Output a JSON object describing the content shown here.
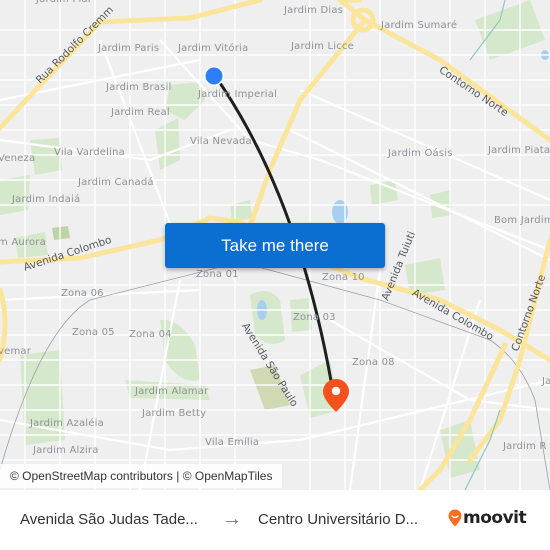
{
  "map": {
    "neighborhood_labels": [
      {
        "id": "jardim-piar",
        "text": "Jardim Piar"
      },
      {
        "id": "jardim-dias",
        "text": "Jardim Dias"
      },
      {
        "id": "jardim-sumare",
        "text": "Jardim Sumaré"
      },
      {
        "id": "jardim-paris",
        "text": "Jardim Paris"
      },
      {
        "id": "jardim-vitoria",
        "text": "Jardim Vitória"
      },
      {
        "id": "jardim-licce",
        "text": "Jardim Licce"
      },
      {
        "id": "jardim-brasil",
        "text": "Jardim Brasil"
      },
      {
        "id": "jardim-imperial",
        "text": "Jardim Imperial"
      },
      {
        "id": "jardim-real",
        "text": "Jardim Real"
      },
      {
        "id": "vila-nevada",
        "text": "Vila Nevada"
      },
      {
        "id": "veneza",
        "text": "Veneza"
      },
      {
        "id": "vila-vardelina",
        "text": "Vila Vardelina"
      },
      {
        "id": "jardim-oasis",
        "text": "Jardim Oásis"
      },
      {
        "id": "jardim-piata",
        "text": "Jardim Piata"
      },
      {
        "id": "jardim-canada",
        "text": "Jardim Canadá"
      },
      {
        "id": "jardim-indaia",
        "text": "Jardim Indaiá"
      },
      {
        "id": "bom-jardim",
        "text": "Bom Jardim"
      },
      {
        "id": "jardim-aurora",
        "text": "m Aurora"
      },
      {
        "id": "zona-01",
        "text": "Zona 01"
      },
      {
        "id": "zona-10",
        "text": "Zona 10"
      },
      {
        "id": "zona-06",
        "text": "Zona 06"
      },
      {
        "id": "zona-03",
        "text": "Zona 03"
      },
      {
        "id": "zona-05",
        "text": "Zona 05"
      },
      {
        "id": "zona-04",
        "text": "Zona 04"
      },
      {
        "id": "zona-08",
        "text": "Zona 08"
      },
      {
        "id": "vemar",
        "text": "vemar"
      },
      {
        "id": "jardim-alamar",
        "text": "Jardim Alamar"
      },
      {
        "id": "jardim-betty",
        "text": "Jardim Betty"
      },
      {
        "id": "jardim-azaleia",
        "text": "Jardim Azaléia"
      },
      {
        "id": "vila-emilia",
        "text": "Vila Emília"
      },
      {
        "id": "jardim-alzira",
        "text": "Jardim Alzira"
      },
      {
        "id": "jardim-r",
        "text": "Jardim R"
      },
      {
        "id": "ja",
        "text": "Ja"
      }
    ],
    "road_labels": [
      {
        "id": "rua-rodolfo-cremm",
        "text": "Rua Rodolfo Cremm"
      },
      {
        "id": "contorno-norte-1",
        "text": "Contorno Norte"
      },
      {
        "id": "avenida-colombo-1",
        "text": "Avenida Colombo"
      },
      {
        "id": "avenida-tuiuti",
        "text": "Avenida Tuiuti"
      },
      {
        "id": "avenida-colombo-2",
        "text": "Avenida Colombo"
      },
      {
        "id": "contorno-norte-2",
        "text": "Contorno Norte"
      },
      {
        "id": "avenida-sao-paulo",
        "text": "Avenida São Paulo"
      }
    ],
    "attribution": "© OpenStreetMap contributors | © OpenMapTiles",
    "colors": {
      "start_marker": "#2d7ff9",
      "end_marker": "#f4511e",
      "route_line": "#1f1f1f",
      "major_road": "#fbe59b",
      "park": "#d3e7c8"
    }
  },
  "cta": {
    "label": "Take me there",
    "color": "#0a6fd1"
  },
  "footer": {
    "origin": "Avenida São Judas Tade...",
    "arrow": "→",
    "destination": "Centro Universitário D...",
    "brand": "moovit",
    "brand_color": "#ff6e1f"
  }
}
